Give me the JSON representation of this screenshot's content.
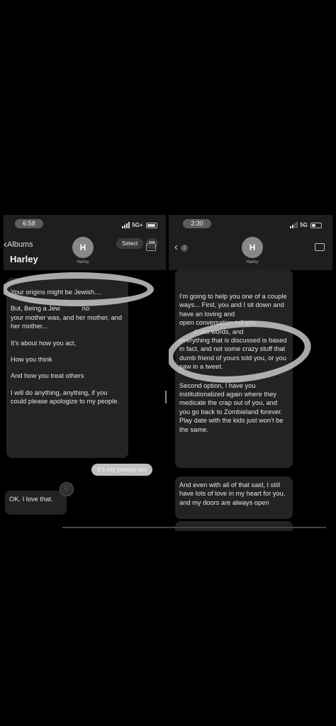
{
  "left": {
    "status": {
      "time": "6:58",
      "network": "5G+"
    },
    "header": {
      "back_label": "Albums",
      "select_label": "Select",
      "more_label": "•••",
      "title": "Harley",
      "avatar_initial": "H",
      "avatar_name": "Harley"
    },
    "messages": {
      "line1": "Your origins might be Jewish....",
      "line2a": "But, Being a Jew",
      "line2b": "no",
      "line3": "your mother was, and her mother, and her mother...",
      "line4": "It's about how you act,",
      "line5": "How you think",
      "line6": "And how you treat others",
      "line7": "I will do anything, anything, if you could please apologize to my people.",
      "sent": "It's my people too",
      "reply": "OK. I love that.",
      "reaction": "♡"
    }
  },
  "right": {
    "status": {
      "time": "2:30",
      "network": "5G"
    },
    "header": {
      "back_badge": "2",
      "avatar_initial": "H",
      "avatar_name": "Harley"
    },
    "messages": {
      "m1a": "I'm going to help you one of a couple ways... First, you and I sit down and have an loving and",
      "m1b": "open  conversation  tell you",
      "m1c": "d  uss words, and",
      "m1d": "everything that is discussed is based in fact, and not some crazy stuff that dumb friend of yours told you, or you saw in a tweet.",
      "m2": "Second option, I have you institutionalized again where they medicate the crap out of you, and you go back to Zombieland forever. Play date with the kids just won't be the same.",
      "m3": "And even with all of that said, I still have lots of love in my heart for you, and my doors are always open"
    }
  }
}
